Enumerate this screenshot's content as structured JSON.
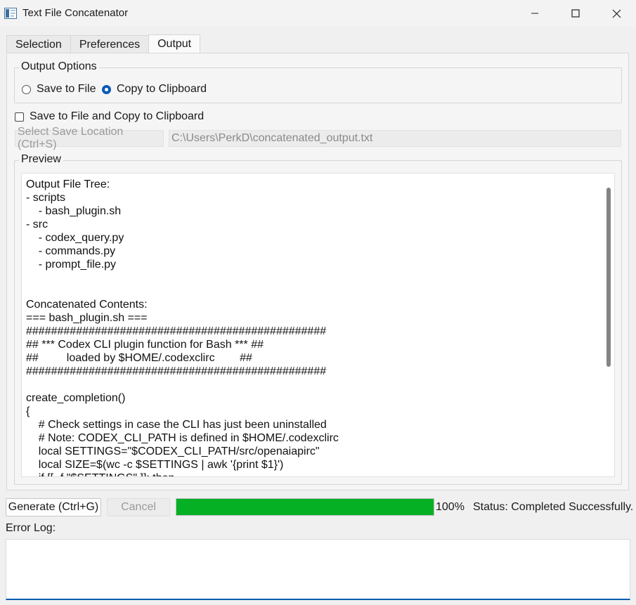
{
  "window": {
    "title": "Text File Concatenator",
    "minimize_glyph": "—",
    "maximize_icon": "square-icon",
    "close_icon": "x-icon"
  },
  "tabs": [
    {
      "label": "Selection",
      "active": false
    },
    {
      "label": "Preferences",
      "active": false
    },
    {
      "label": "Output",
      "active": true
    }
  ],
  "output_options": {
    "title": "Output Options",
    "save_to_file": {
      "label": "Save to File",
      "checked": false
    },
    "copy_to_clipboard": {
      "label": "Copy to Clipboard",
      "checked": true
    }
  },
  "save_and_copy": {
    "label": "Save to File and Copy to Clipboard",
    "checked": false
  },
  "save_location": {
    "button_label": "Select Save Location (Ctrl+S)",
    "path": "C:\\Users\\PerkD\\concatenated_output.txt"
  },
  "preview": {
    "title": "Preview",
    "lines": [
      "Output File Tree:",
      "- scripts",
      "    - bash_plugin.sh",
      "- src",
      "    - codex_query.py",
      "    - commands.py",
      "    - prompt_file.py",
      "",
      "",
      "Concatenated Contents:",
      "=== bash_plugin.sh ===",
      "################################################",
      "## *** Codex CLI plugin function for Bash *** ##",
      "##         loaded by $HOME/.codexclirc        ##",
      "################################################",
      "",
      "create_completion()",
      "{",
      "    # Check settings in case the CLI has just been uninstalled",
      "    # Note: CODEX_CLI_PATH is defined in $HOME/.codexclirc",
      "    local SETTINGS=\"$CODEX_CLI_PATH/src/openaiapirc\"",
      "    local SIZE=$(wc -c $SETTINGS | awk '{print $1}')",
      "    if [[ -f \"$SETTINGS\" ]]; then"
    ]
  },
  "actions": {
    "generate_label": "Generate (Ctrl+G)",
    "cancel_label": "Cancel"
  },
  "progress": {
    "value": 100,
    "text": "100%"
  },
  "status": "Status: Completed Successfully.",
  "error_log": {
    "label": "Error Log:",
    "value": ""
  },
  "colors": {
    "progress_fill": "#06b025",
    "accent": "#0a5ab8"
  }
}
